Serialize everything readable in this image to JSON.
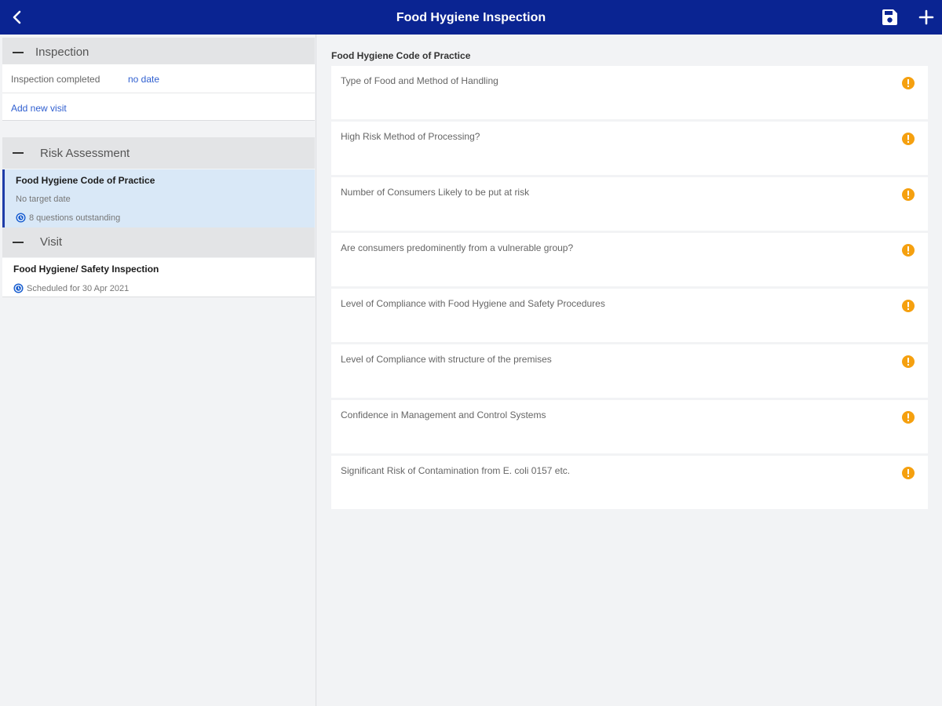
{
  "header": {
    "title": "Food Hygiene Inspection",
    "bg_color": "#0a2492"
  },
  "inspection": {
    "section_label": "Inspection",
    "completed_label": "Inspection completed",
    "completed_value": "no date",
    "add_visit_label": "Add new visit"
  },
  "risk_assessment": {
    "section_label": "Risk Assessment",
    "item_title": "Food Hygiene Code of Practice",
    "item_sub": "No target date",
    "item_status": "8 questions outstanding"
  },
  "visit": {
    "section_label": "Visit",
    "item_title": "Food Hygiene/ Safety Inspection",
    "item_status": "Scheduled for 30 Apr 2021"
  },
  "detail": {
    "heading": "Food Hygiene Code of Practice",
    "questions": [
      "Type of Food and Method of Handling",
      "High Risk Method of Processing?",
      "Number of Consumers Likely to be put at risk",
      "Are consumers predominently from a vulnerable group?",
      "Level of Compliance with Food Hygiene and Safety Procedures",
      "Level of Compliance with structure of the premises",
      "Confidence in Management and Control Systems",
      "Significant Risk of Contamination from E. coli 0157 etc."
    ],
    "warning_color": "#f5a00f"
  }
}
